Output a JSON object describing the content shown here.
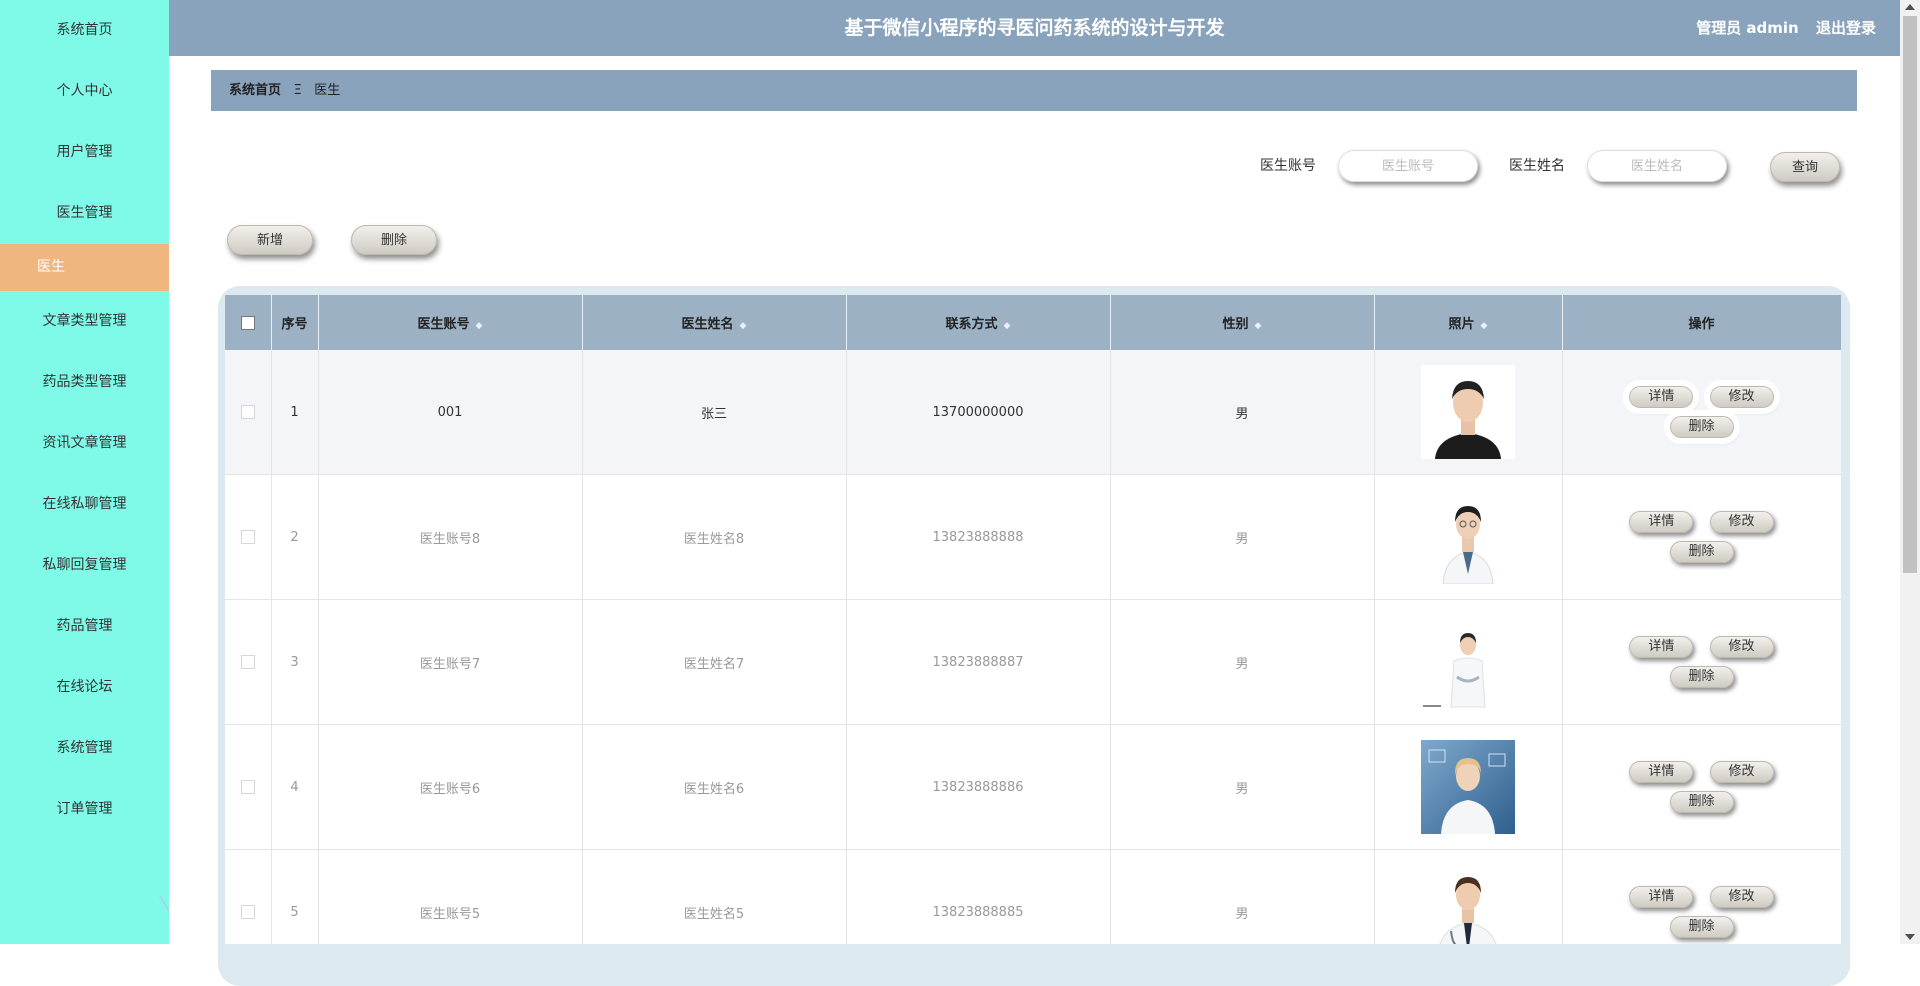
{
  "app": {
    "title": "基于微信小程序的寻医问药系统的设计与开发",
    "user_label": "管理员 admin",
    "logout_label": "退出登录"
  },
  "sidebar": {
    "items": [
      {
        "label": "系统首页"
      },
      {
        "label": "个人中心"
      },
      {
        "label": "用户管理"
      },
      {
        "label": "医生管理"
      },
      {
        "label": "医生",
        "active": true
      },
      {
        "label": "文章类型管理"
      },
      {
        "label": "药品类型管理"
      },
      {
        "label": "资讯文章管理"
      },
      {
        "label": "在线私聊管理"
      },
      {
        "label": "私聊回复管理"
      },
      {
        "label": "药品管理"
      },
      {
        "label": "在线论坛"
      },
      {
        "label": "系统管理"
      },
      {
        "label": "订单管理"
      }
    ]
  },
  "breadcrumb": {
    "home": "系统首页",
    "separator": "Ξ",
    "current": "医生"
  },
  "search": {
    "account_label": "医生账号",
    "account_placeholder": "医生账号",
    "name_label": "医生姓名",
    "name_placeholder": "医生姓名",
    "query_label": "查询"
  },
  "toolbar": {
    "add_label": "新增",
    "delete_label": "删除"
  },
  "table": {
    "headers": {
      "index": "序号",
      "account": "医生账号",
      "name": "医生姓名",
      "phone": "联系方式",
      "gender": "性别",
      "photo": "照片",
      "actions": "操作"
    },
    "sort_glyph": "◆",
    "rows": [
      {
        "index": "1",
        "account": "001",
        "name": "张三",
        "phone": "13700000000",
        "gender": "男"
      },
      {
        "index": "2",
        "account": "医生账号8",
        "name": "医生姓名8",
        "phone": "13823888888",
        "gender": "男"
      },
      {
        "index": "3",
        "account": "医生账号7",
        "name": "医生姓名7",
        "phone": "13823888887",
        "gender": "男"
      },
      {
        "index": "4",
        "account": "医生账号6",
        "name": "医生姓名6",
        "phone": "13823888886",
        "gender": "男"
      },
      {
        "index": "5",
        "account": "医生账号5",
        "name": "医生姓名5",
        "phone": "13823888885",
        "gender": "男"
      }
    ],
    "row_actions": {
      "detail": "详情",
      "edit": "修改",
      "delete": "删除"
    }
  },
  "colors": {
    "sidebar_bg": "#7ff9e8",
    "active_item": "#f0b680",
    "header_bg": "#8aa3bc",
    "table_header": "#9cb1c4"
  }
}
